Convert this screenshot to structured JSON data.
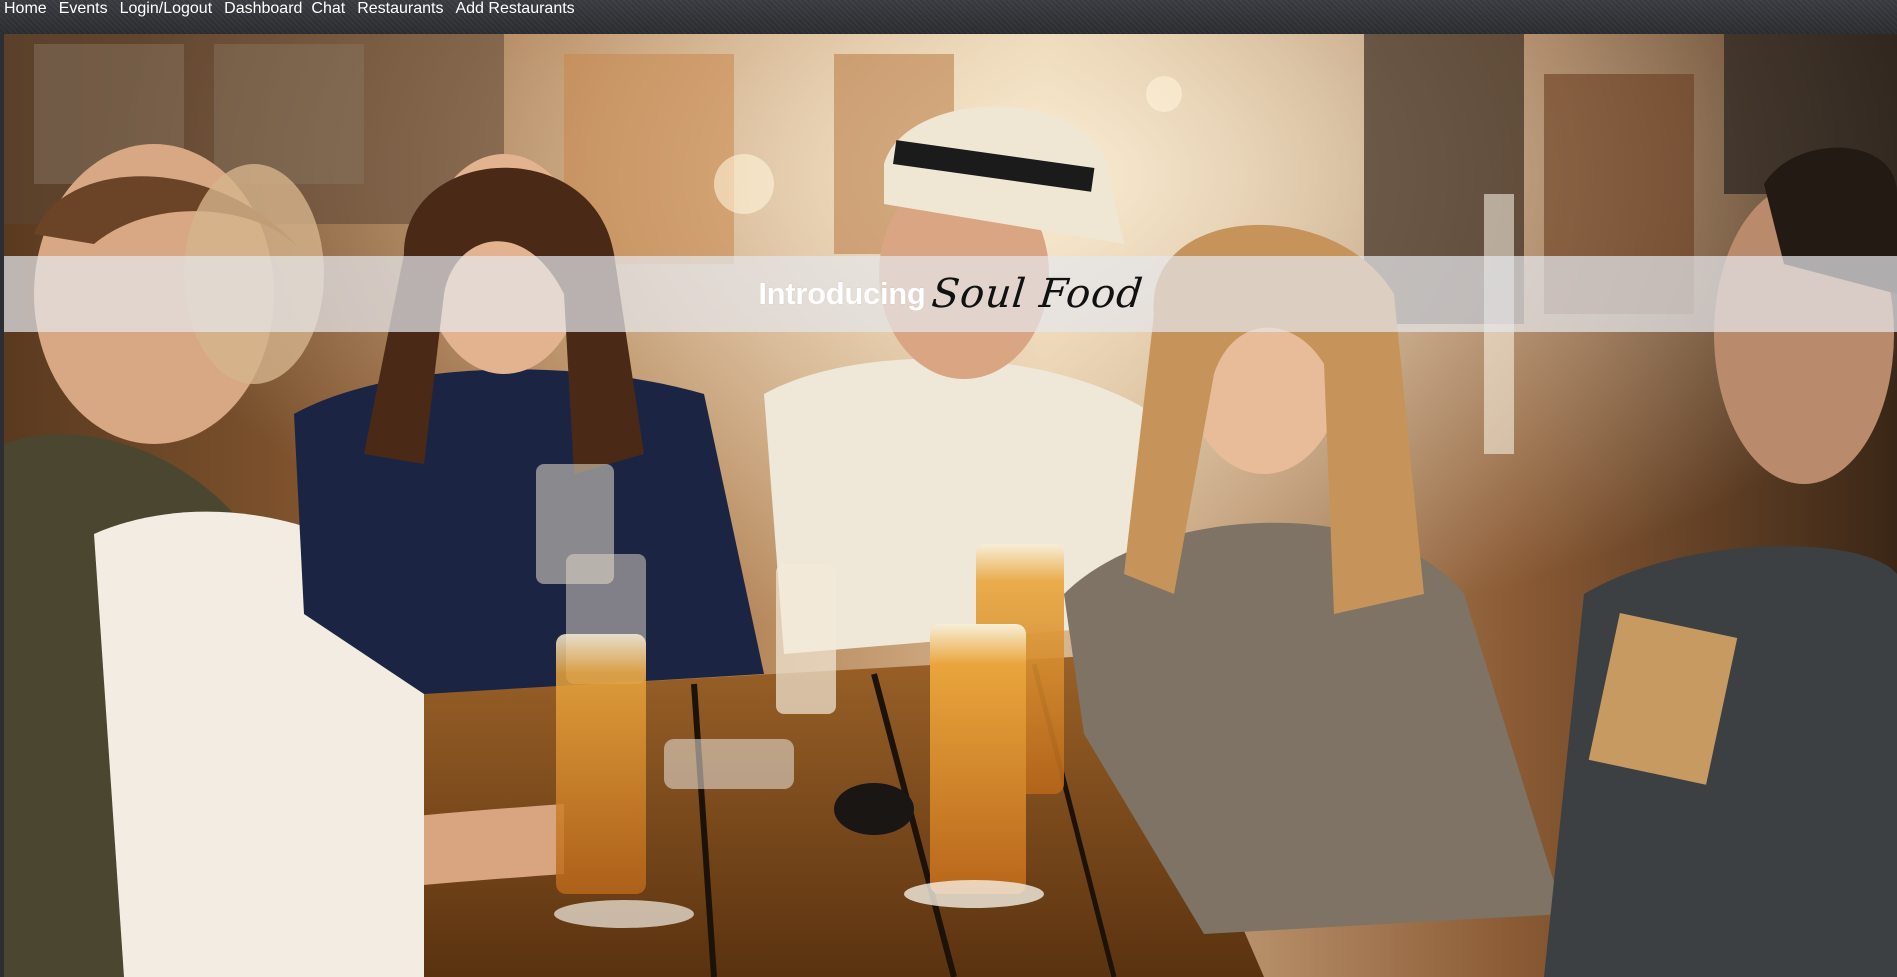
{
  "nav": {
    "items": [
      {
        "label": "Home"
      },
      {
        "label": "Events"
      },
      {
        "label": "Login/Logout"
      },
      {
        "label": "Dashboard"
      },
      {
        "label": "Chat"
      },
      {
        "label": "Restaurants"
      },
      {
        "label": "Add Restaurants"
      }
    ]
  },
  "hero": {
    "image_alt": "Friends laughing around a bar table with beer glasses",
    "banner_intro": "Introducing",
    "banner_brand": "Soul Food"
  },
  "colors": {
    "nav_background": "#2f3136",
    "nav_text": "#ffffff",
    "banner_overlay": "#e4e6ea",
    "brand_text": "#111111"
  }
}
